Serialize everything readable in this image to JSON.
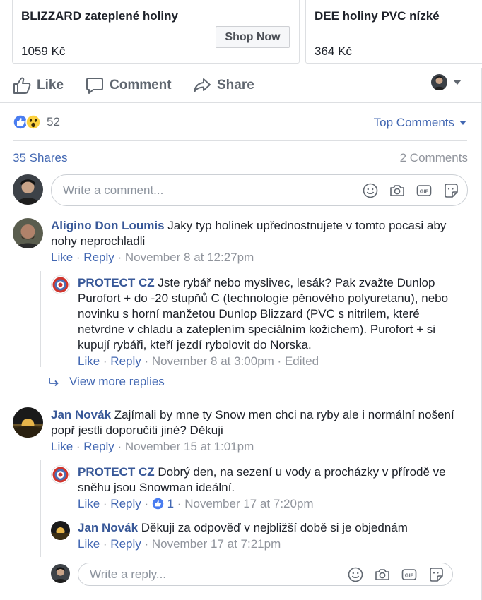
{
  "cards": [
    {
      "title": "BLIZZARD zateplené holiny",
      "price": "1059 Kč",
      "button": "Shop Now"
    },
    {
      "title": "DEE holiny PVC nízké",
      "price": "364 Kč"
    }
  ],
  "actions": {
    "like": "Like",
    "comment": "Comment",
    "share": "Share"
  },
  "reactions": {
    "count": "52",
    "top_comments": "Top Comments"
  },
  "stats": {
    "shares": "35 Shares",
    "comments": "2 Comments"
  },
  "composer": {
    "placeholder": "Write a comment..."
  },
  "reply_composer": {
    "placeholder": "Write a reply..."
  },
  "view_more_replies": "View more replies",
  "comments": [
    {
      "author": "Aligino Don Loumis",
      "text": "Jaky typ holinek upřednostnujete v tomto pocasi aby nohy neprochladli",
      "like": "Like",
      "reply": "Reply",
      "time": "November 8 at 12:27pm"
    },
    {
      "author": "PROTECT CZ",
      "text": "Jste rybář nebo myslivec, lesák? Pak zvažte Dunlop Purofort + do -20 stupňů C (technologie pěnového polyuretanu), nebo novinku s horní manžetou Dunlop Blizzard (PVC s nitrilem, které netvrdne v chladu a zateplením speciálním kožichem). Purofort + si kupují rybáři, kteří jezdí rybolovit do Norska.",
      "like": "Like",
      "reply": "Reply",
      "time": "November 8 at 3:00pm",
      "edited": "Edited"
    },
    {
      "author": "Jan Novák",
      "text": "Zajímali by mne ty Snow men chci na ryby ale i normální nošení popř jestli doporučiti jiné? Děkuji",
      "like": "Like",
      "reply": "Reply",
      "time": "November 15 at 1:01pm"
    },
    {
      "author": "PROTECT CZ",
      "text": "Dobrý den, na sezení u vody a procházky v přírodě ve sněhu jsou Snowman ideální.",
      "like": "Like",
      "reply": "Reply",
      "likes": "1",
      "time": "November 17 at 7:20pm"
    },
    {
      "author": "Jan Novák",
      "text": "Děkuji za odpověď v nejbližší době si je objednám",
      "like": "Like",
      "reply": "Reply",
      "time": "November 17 at 7:21pm"
    }
  ],
  "colors": {
    "link": "#4267b2",
    "author": "#385898",
    "meta": "#90949c",
    "protect_red": "#d0342c"
  },
  "icons": [
    "thumbs-up-icon",
    "comment-bubble-icon",
    "share-arrow-icon",
    "chevron-down-icon",
    "like-reaction-icon",
    "wow-reaction-icon",
    "emoji-icon",
    "camera-icon",
    "gif-icon",
    "sticker-icon",
    "reply-arrow-icon"
  ]
}
